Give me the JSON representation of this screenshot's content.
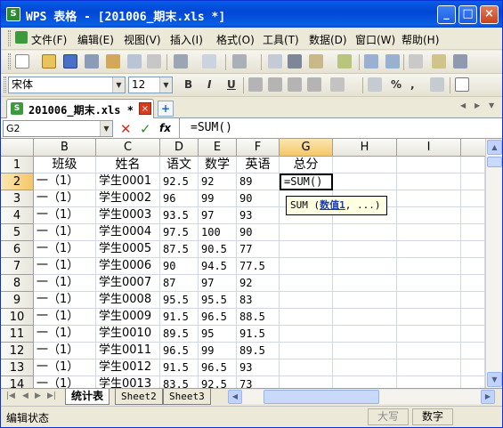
{
  "window": {
    "title": "WPS 表格 - [201006_期末.xls *]",
    "app_icon": "S",
    "controls": [
      "_",
      "□",
      "×"
    ]
  },
  "menu": {
    "items": [
      "文件(F)",
      "编辑(E)",
      "视图(V)",
      "插入(I)",
      "格式(O)",
      "工具(T)",
      "数据(D)",
      "窗口(W)",
      "帮助(H)"
    ]
  },
  "format_toolbar": {
    "font_name": "宋体",
    "font_size": "12",
    "bold": "B",
    "italic": "I",
    "underline": "U",
    "percent": "%",
    "comma": ","
  },
  "doc_tab": {
    "label": "201006_期末.xls *",
    "icon": "S",
    "close": "×",
    "new_tab": "+"
  },
  "formula_bar": {
    "name_box": "G2",
    "cancel": "✕",
    "confirm": "✓",
    "fx": "fx",
    "formula": "=SUM()"
  },
  "sheet": {
    "columns": [
      "B",
      "C",
      "D",
      "E",
      "F",
      "G",
      "H",
      "I"
    ],
    "selected_column": "G",
    "selected_row": "2",
    "header_row": {
      "row": "1",
      "cells": [
        "班级",
        "姓名",
        "语文",
        "数学",
        "英语",
        "总分"
      ]
    },
    "rows": [
      {
        "row": "2",
        "class": "一（1）",
        "name": "学生0001",
        "chinese": "92.5",
        "math": "92",
        "english": "89",
        "total": "=SUM()"
      },
      {
        "row": "3",
        "class": "一（1）",
        "name": "学生0002",
        "chinese": "96",
        "math": "99",
        "english": "90",
        "total": ""
      },
      {
        "row": "4",
        "class": "一（1）",
        "name": "学生0003",
        "chinese": "93.5",
        "math": "97",
        "english": "93",
        "total": ""
      },
      {
        "row": "5",
        "class": "一（1）",
        "name": "学生0004",
        "chinese": "97.5",
        "math": "100",
        "english": "90",
        "total": ""
      },
      {
        "row": "6",
        "class": "一（1）",
        "name": "学生0005",
        "chinese": "87.5",
        "math": "90.5",
        "english": "77",
        "total": ""
      },
      {
        "row": "7",
        "class": "一（1）",
        "name": "学生0006",
        "chinese": "90",
        "math": "94.5",
        "english": "77.5",
        "total": ""
      },
      {
        "row": "8",
        "class": "一（1）",
        "name": "学生0007",
        "chinese": "87",
        "math": "97",
        "english": "92",
        "total": ""
      },
      {
        "row": "9",
        "class": "一（1）",
        "name": "学生0008",
        "chinese": "95.5",
        "math": "95.5",
        "english": "83",
        "total": ""
      },
      {
        "row": "10",
        "class": "一（1）",
        "name": "学生0009",
        "chinese": "91.5",
        "math": "96.5",
        "english": "88.5",
        "total": ""
      },
      {
        "row": "11",
        "class": "一（1）",
        "name": "学生0010",
        "chinese": "89.5",
        "math": "95",
        "english": "91.5",
        "total": ""
      },
      {
        "row": "12",
        "class": "一（1）",
        "name": "学生0011",
        "chinese": "96.5",
        "math": "99",
        "english": "89.5",
        "total": ""
      },
      {
        "row": "13",
        "class": "一（1）",
        "name": "学生0012",
        "chinese": "91.5",
        "math": "96.5",
        "english": "93",
        "total": ""
      },
      {
        "row": "14",
        "class": "一（1）",
        "name": "学生0013",
        "chinese": "83.5",
        "math": "92.5",
        "english": "73",
        "total": ""
      }
    ]
  },
  "tooltip": {
    "func": "SUM",
    "open": "(",
    "arg": "数值1",
    "rest": ", ...)"
  },
  "sheet_tabs": [
    "统计表",
    "Sheet2",
    "Sheet3"
  ],
  "active_sheet": "统计表",
  "status": {
    "message": "编辑状态",
    "caps": "大写",
    "num": "数字"
  }
}
